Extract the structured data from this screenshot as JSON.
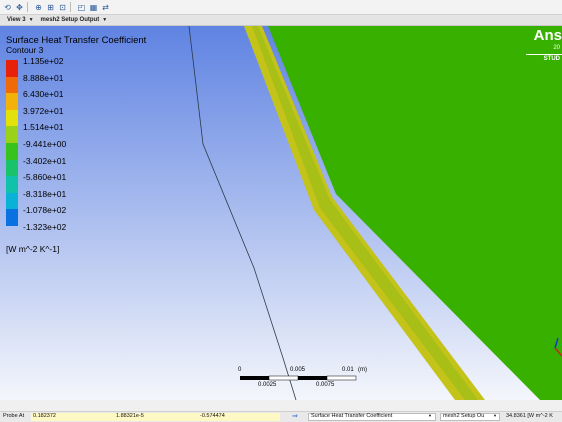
{
  "toolbar": {
    "icons": [
      "rotate-icon",
      "pan-icon",
      "zoom-icon",
      "zoom-box-icon",
      "zoom-fit-icon",
      "view-icon",
      "layout-icon",
      "sync-icon"
    ]
  },
  "viewbar": {
    "view_label": "View 3",
    "setup_label": "mesh2 Setup Output"
  },
  "legend": {
    "title": "Surface Heat Transfer Coefficient",
    "subtitle": "Contour 3",
    "values": [
      "1.135e+02",
      "8.888e+01",
      "6.430e+01",
      "3.972e+01",
      "1.514e+01",
      "-9.441e+00",
      "-3.402e+01",
      "-5.860e+01",
      "-8.318e+01",
      "-1.078e+02",
      "-1.323e+02"
    ],
    "colors": [
      "#e8220a",
      "#f06a0a",
      "#f2b20a",
      "#e2e20a",
      "#9ad21a",
      "#38c21c",
      "#1ac26a",
      "#10c2aa",
      "#0ab2d8",
      "#0a72e0",
      "#0a2ae0"
    ],
    "unit": "[W m^-2 K^-1]"
  },
  "brand": {
    "name": "Ans",
    "year": "20",
    "edition": "STUD"
  },
  "scale": {
    "labels": [
      "0",
      "0.005",
      "0.01",
      "(m)",
      "0.0025",
      "0.0075"
    ]
  },
  "statusbar": {
    "probe_label": "Probe At",
    "x": "0.182372",
    "y": "1.88321e-5",
    "z": "-0.574474",
    "variable": "Surface Heat Transfer Coefficient",
    "location": "mesh2 Setup Ou",
    "value": "34.8361 [W m^-2 K"
  },
  "colors": {
    "background_top": "#5f83e2",
    "background_bottom": "#f4f6fb",
    "surface": "#37b000",
    "edge_band": "#a7bf16"
  }
}
